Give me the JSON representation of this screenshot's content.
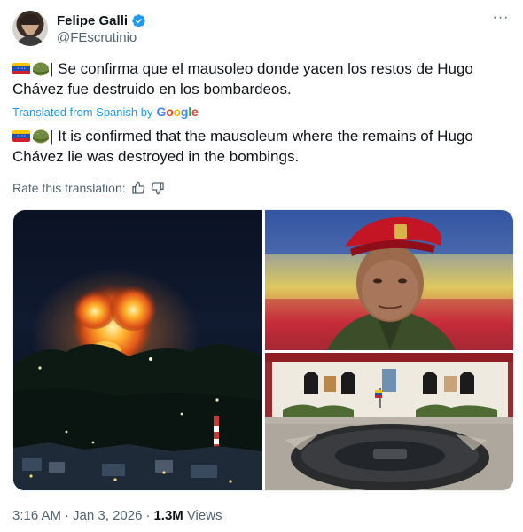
{
  "author": {
    "name": "Felipe Galli",
    "handle": "@FEscrutinio",
    "verified_color": "#1d9bf0"
  },
  "menu": {
    "more_label": "···"
  },
  "tweet": {
    "original_text": "| Se confirma que el mausoleo donde yacen los restos de Hugo Chávez fue destruido en los bombardeos.",
    "translated_prefix": "Translated from Spanish by",
    "translator": "Google",
    "translated_text": "| It is confirmed that the mausoleum where the remains of Hugo Chávez lie was destroyed in the bombings.",
    "emoji_icons": [
      "venezuela-flag-icon",
      "military-helmet-icon"
    ]
  },
  "rating": {
    "label": "Rate this translation:",
    "icons": [
      "thumbs-up-icon",
      "thumbs-down-icon"
    ]
  },
  "media": {
    "images": [
      "night-fire-explosion-photo",
      "hugo-chavez-portrait-photo",
      "mausoleum-interior-photo"
    ]
  },
  "meta": {
    "time": "3:16 AM",
    "separator": "·",
    "date": "Jan 3, 2026",
    "views_count": "1.3M",
    "views_label": "Views"
  },
  "colors": {
    "text": "#0f1419",
    "secondary": "#536471",
    "link": "#1d9bf0"
  }
}
